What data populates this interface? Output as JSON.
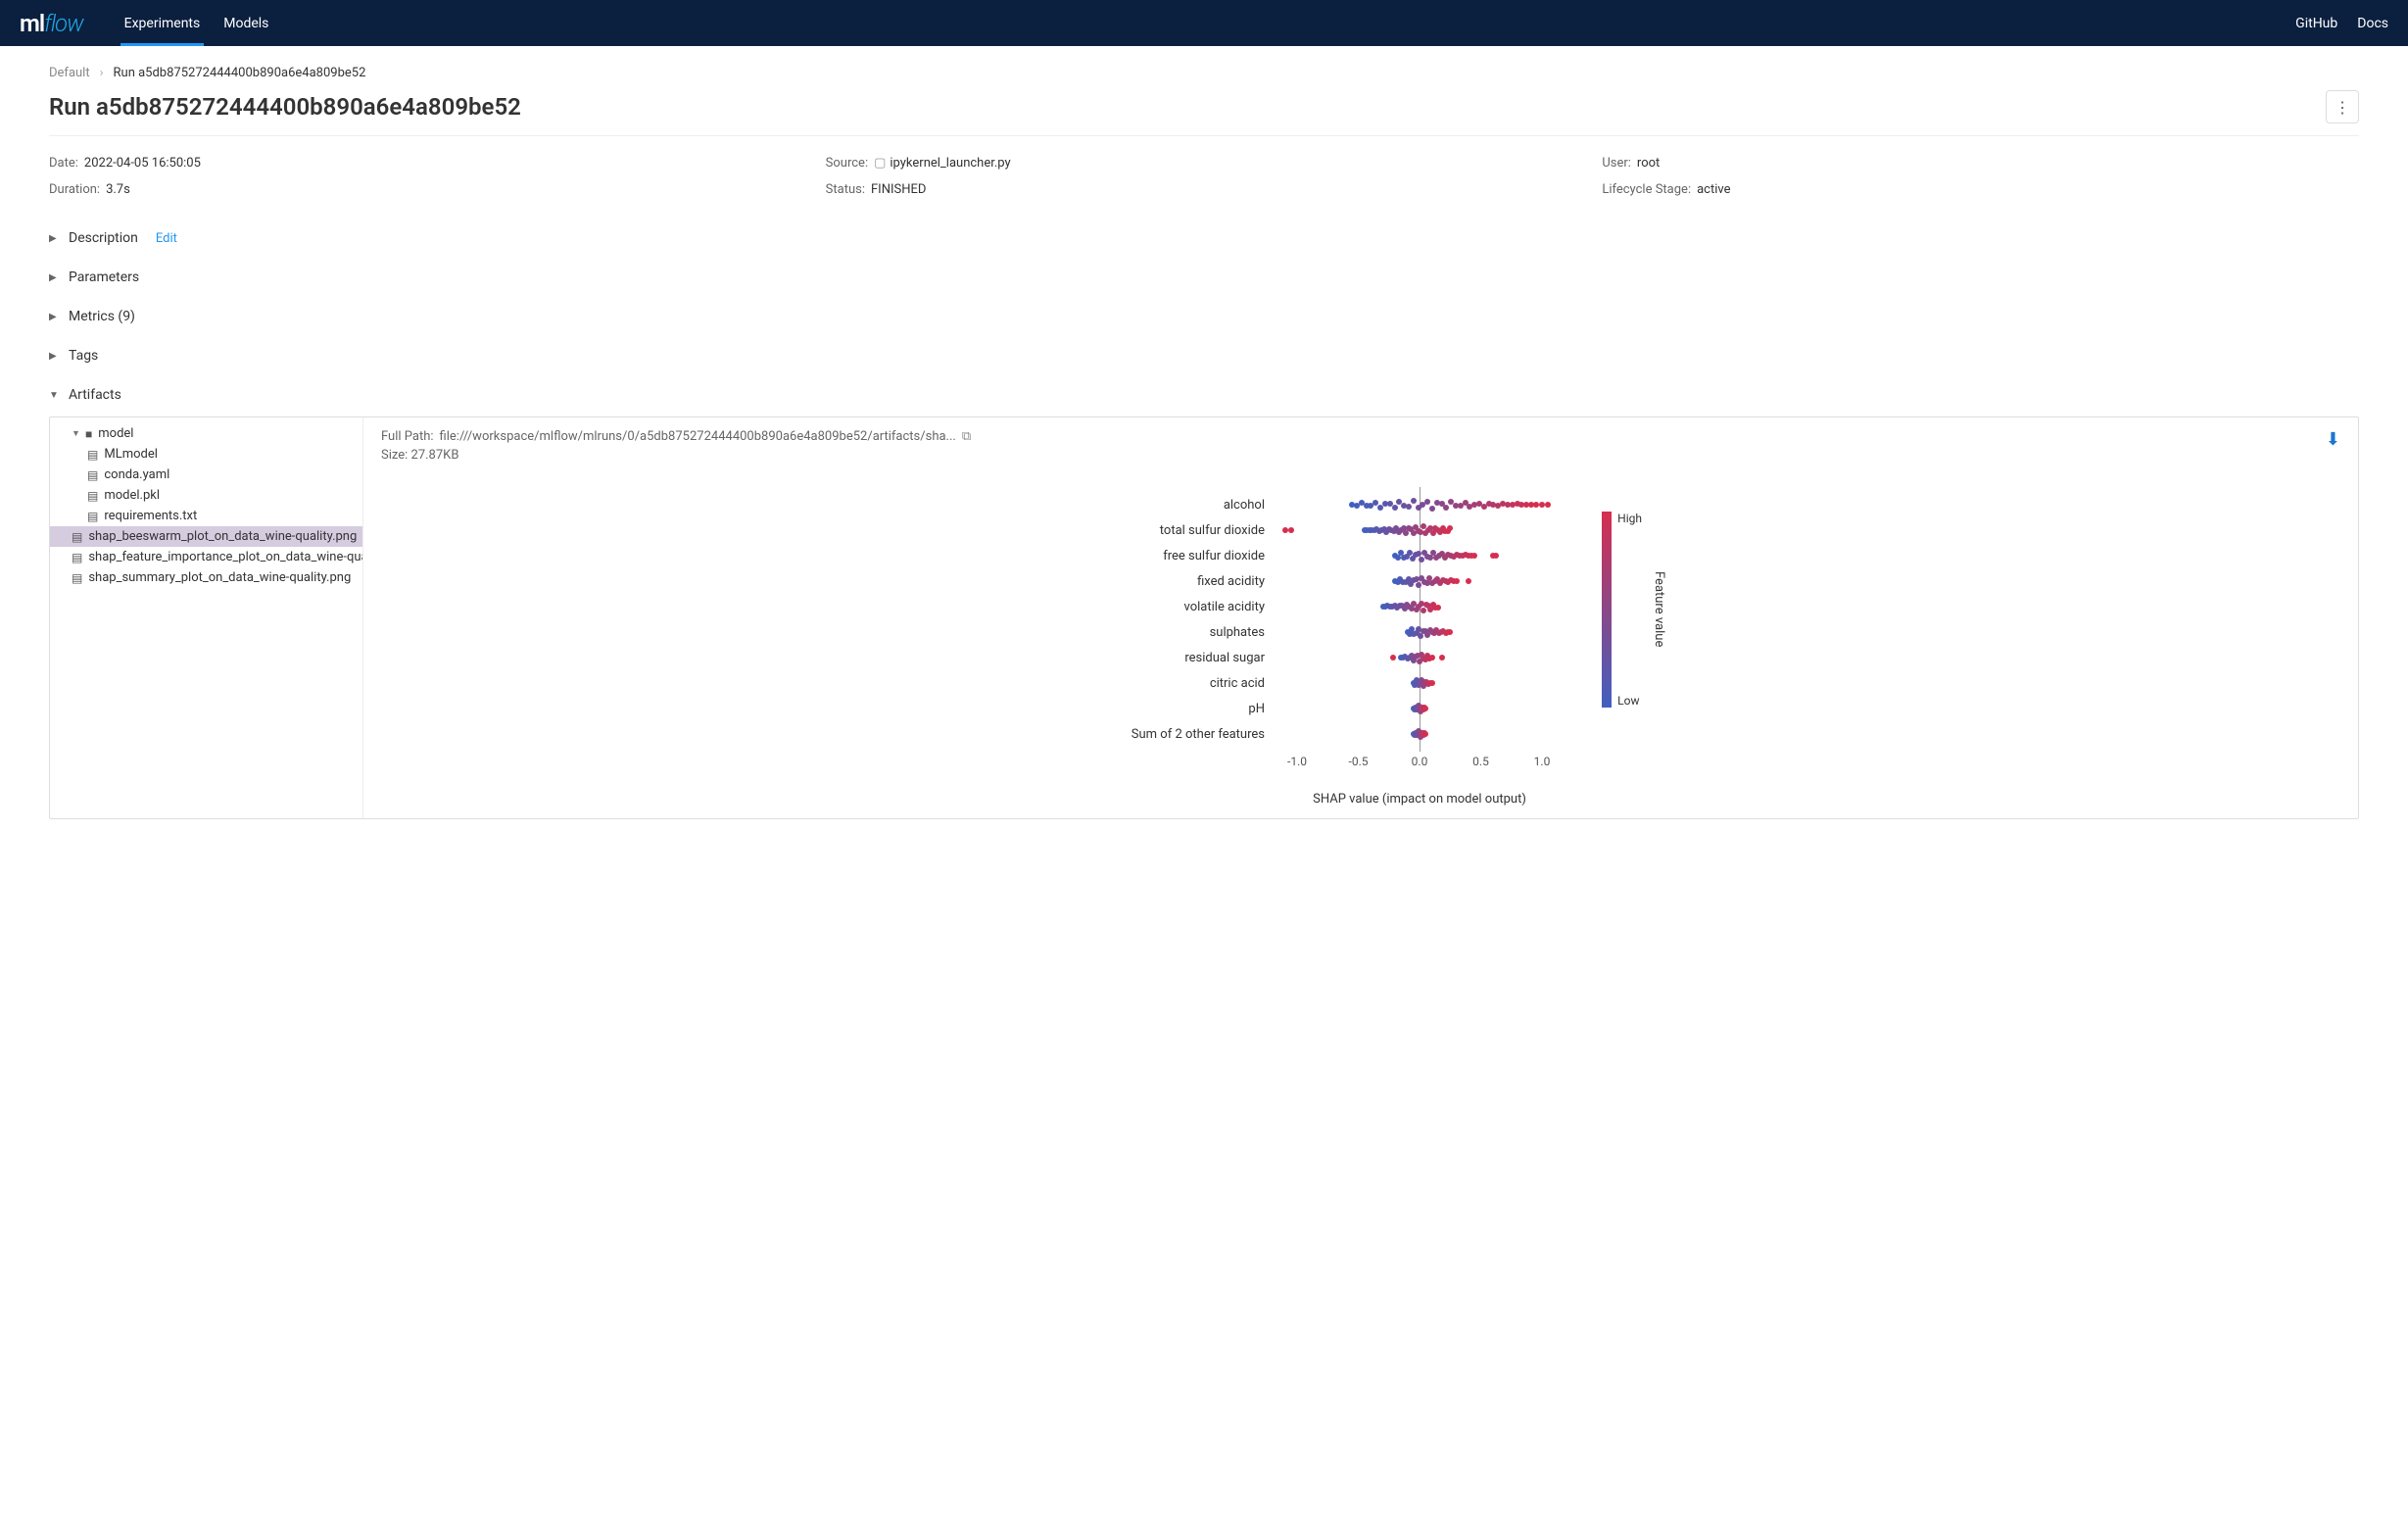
{
  "nav": {
    "logo_ml": "ml",
    "logo_flow": "flow",
    "tabs": {
      "experiments": "Experiments",
      "models": "Models"
    },
    "links": {
      "github": "GitHub",
      "docs": "Docs"
    }
  },
  "breadcrumb": {
    "root": "Default",
    "current": "Run a5db875272444400b890a6e4a809be52"
  },
  "title": "Run a5db875272444400b890a6e4a809be52",
  "meta": {
    "date_label": "Date:",
    "date_value": "2022-04-05 16:50:05",
    "source_label": "Source:",
    "source_value": "ipykernel_launcher.py",
    "user_label": "User:",
    "user_value": "root",
    "duration_label": "Duration:",
    "duration_value": "3.7s",
    "status_label": "Status:",
    "status_value": "FINISHED",
    "lifecycle_label": "Lifecycle Stage:",
    "lifecycle_value": "active"
  },
  "sections": {
    "description": "Description",
    "edit": "Edit",
    "parameters": "Parameters",
    "metrics": "Metrics (9)",
    "tags": "Tags",
    "artifacts": "Artifacts"
  },
  "tree": {
    "model": "model",
    "mlmodel": "MLmodel",
    "conda": "conda.yaml",
    "modelpkl": "model.pkl",
    "requirements": "requirements.txt",
    "beeswarm": "shap_beeswarm_plot_on_data_wine-quality.png",
    "importance": "shap_feature_importance_plot_on_data_wine-qualit",
    "summary": "shap_summary_plot_on_data_wine-quality.png"
  },
  "artifact": {
    "path_label": "Full Path:",
    "path_value": "file:///workspace/mlflow/mlruns/0/a5db875272444400b890a6e4a809be52/artifacts/sha...",
    "size_label": "Size:",
    "size_value": "27.87KB"
  },
  "chart_data": {
    "type": "beeswarm",
    "xlabel": "SHAP value (impact on model output)",
    "x_ticks": [
      -1.0,
      -0.5,
      0.0,
      0.5,
      1.0
    ],
    "xlim": [
      -1.2,
      1.2
    ],
    "colorbar": {
      "title": "Feature value",
      "high": "High",
      "low": "Low"
    },
    "features": [
      {
        "name": "alcohol",
        "spread": [
          -0.55,
          0.95
        ],
        "density": 1.0,
        "outliers": [
          1.0,
          1.05
        ]
      },
      {
        "name": "total sulfur dioxide",
        "spread": [
          -0.45,
          0.25
        ],
        "density": 0.9,
        "outliers": [
          -1.1,
          -1.05
        ]
      },
      {
        "name": "free sulfur dioxide",
        "spread": [
          -0.2,
          0.45
        ],
        "density": 0.7,
        "outliers": [
          0.6,
          0.62
        ]
      },
      {
        "name": "fixed acidity",
        "spread": [
          -0.2,
          0.3
        ],
        "density": 0.6,
        "outliers": [
          0.4
        ]
      },
      {
        "name": "volatile acidity",
        "spread": [
          -0.3,
          0.15
        ],
        "density": 0.6,
        "outliers": []
      },
      {
        "name": "sulphates",
        "spread": [
          -0.1,
          0.25
        ],
        "density": 0.5,
        "outliers": []
      },
      {
        "name": "residual sugar",
        "spread": [
          -0.15,
          0.1
        ],
        "density": 0.4,
        "outliers": [
          -0.22,
          0.18
        ]
      },
      {
        "name": "citric acid",
        "spread": [
          -0.05,
          0.1
        ],
        "density": 0.3,
        "outliers": []
      },
      {
        "name": "pH",
        "spread": [
          -0.05,
          0.05
        ],
        "density": 0.3,
        "outliers": []
      },
      {
        "name": "Sum of 2 other features",
        "spread": [
          -0.05,
          0.05
        ],
        "density": 0.3,
        "outliers": []
      }
    ]
  }
}
